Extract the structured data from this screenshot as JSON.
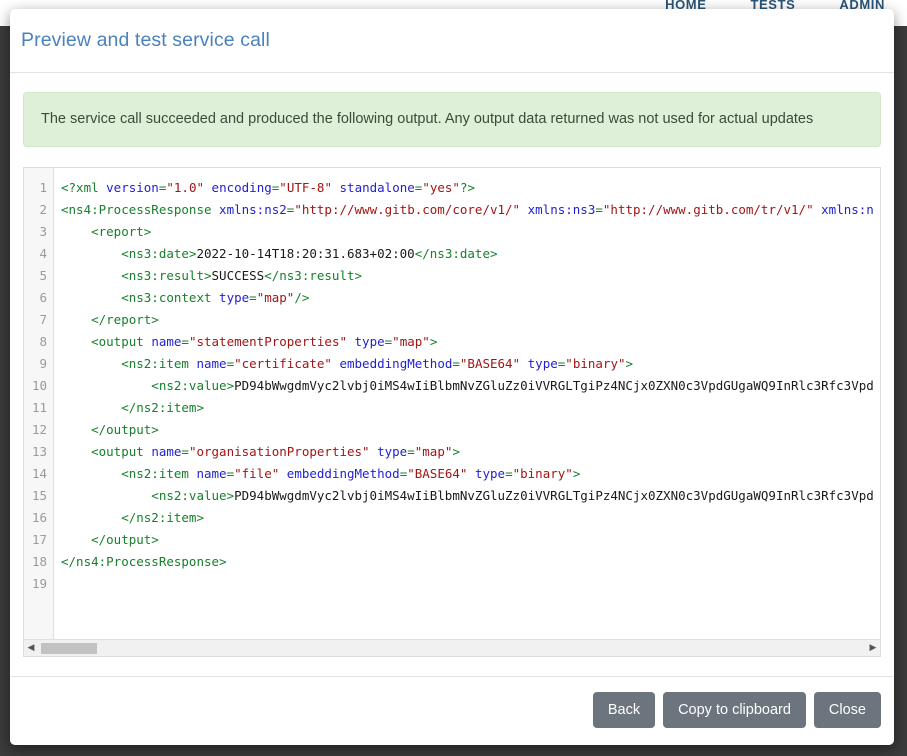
{
  "background_nav": {
    "links": [
      {
        "label": "HOME"
      },
      {
        "label": "TESTS"
      },
      {
        "label": "ADMIN"
      }
    ]
  },
  "modal": {
    "title": "Preview and test service call",
    "alert": {
      "type": "success",
      "bg_color": "#dff0d8",
      "message": "The service call succeeded and produced the following output. Any output data returned was not used for actual updates"
    },
    "editor": {
      "language": "xml",
      "line_count": 19,
      "line_numbers": [
        "1",
        "2",
        "3",
        "4",
        "5",
        "6",
        "7",
        "8",
        "9",
        "10",
        "11",
        "12",
        "13",
        "14",
        "15",
        "16",
        "17",
        "18",
        "19"
      ],
      "lines": [
        {
          "n": "1",
          "tokens": [
            {
              "t": "punct",
              "v": "<?xml "
            },
            {
              "t": "attr",
              "v": "version"
            },
            {
              "t": "punct",
              "v": "="
            },
            {
              "t": "val",
              "v": "\"1.0\""
            },
            {
              "t": "punct",
              "v": " "
            },
            {
              "t": "attr",
              "v": "encoding"
            },
            {
              "t": "punct",
              "v": "="
            },
            {
              "t": "val",
              "v": "\"UTF-8\""
            },
            {
              "t": "punct",
              "v": " "
            },
            {
              "t": "attr",
              "v": "standalone"
            },
            {
              "t": "punct",
              "v": "="
            },
            {
              "t": "val",
              "v": "\"yes\""
            },
            {
              "t": "punct",
              "v": "?>"
            }
          ]
        },
        {
          "n": "2",
          "tokens": [
            {
              "t": "tag",
              "v": "<ns4:ProcessResponse "
            },
            {
              "t": "attr",
              "v": "xmlns:ns2"
            },
            {
              "t": "punct",
              "v": "="
            },
            {
              "t": "val",
              "v": "\"http://www.gitb.com/core/v1/\""
            },
            {
              "t": "punct",
              "v": " "
            },
            {
              "t": "attr",
              "v": "xmlns:ns3"
            },
            {
              "t": "punct",
              "v": "="
            },
            {
              "t": "val",
              "v": "\"http://www.gitb.com/tr/v1/\""
            },
            {
              "t": "punct",
              "v": " "
            },
            {
              "t": "attr",
              "v": "xmlns:n"
            }
          ]
        },
        {
          "n": "3",
          "tokens": [
            {
              "t": "tag",
              "v": "    <report>"
            }
          ]
        },
        {
          "n": "4",
          "tokens": [
            {
              "t": "tag",
              "v": "        <ns3:date>"
            },
            {
              "t": "text",
              "v": "2022-10-14T18:20:31.683+02:00"
            },
            {
              "t": "tag",
              "v": "</ns3:date>"
            }
          ]
        },
        {
          "n": "5",
          "tokens": [
            {
              "t": "tag",
              "v": "        <ns3:result>"
            },
            {
              "t": "text",
              "v": "SUCCESS"
            },
            {
              "t": "tag",
              "v": "</ns3:result>"
            }
          ]
        },
        {
          "n": "6",
          "tokens": [
            {
              "t": "tag",
              "v": "        <ns3:context "
            },
            {
              "t": "attr",
              "v": "type"
            },
            {
              "t": "punct",
              "v": "="
            },
            {
              "t": "val",
              "v": "\"map\""
            },
            {
              "t": "tag",
              "v": "/>"
            }
          ]
        },
        {
          "n": "7",
          "tokens": [
            {
              "t": "tag",
              "v": "    </report>"
            }
          ]
        },
        {
          "n": "8",
          "tokens": [
            {
              "t": "tag",
              "v": "    <output "
            },
            {
              "t": "attr",
              "v": "name"
            },
            {
              "t": "punct",
              "v": "="
            },
            {
              "t": "val",
              "v": "\"statementProperties\""
            },
            {
              "t": "punct",
              "v": " "
            },
            {
              "t": "attr",
              "v": "type"
            },
            {
              "t": "punct",
              "v": "="
            },
            {
              "t": "val",
              "v": "\"map\""
            },
            {
              "t": "tag",
              "v": ">"
            }
          ]
        },
        {
          "n": "9",
          "tokens": [
            {
              "t": "tag",
              "v": "        <ns2:item "
            },
            {
              "t": "attr",
              "v": "name"
            },
            {
              "t": "punct",
              "v": "="
            },
            {
              "t": "val",
              "v": "\"certificate\""
            },
            {
              "t": "punct",
              "v": " "
            },
            {
              "t": "attr",
              "v": "embeddingMethod"
            },
            {
              "t": "punct",
              "v": "="
            },
            {
              "t": "val",
              "v": "\"BASE64\""
            },
            {
              "t": "punct",
              "v": " "
            },
            {
              "t": "attr",
              "v": "type"
            },
            {
              "t": "punct",
              "v": "="
            },
            {
              "t": "val",
              "v": "\"binary\""
            },
            {
              "t": "tag",
              "v": ">"
            }
          ]
        },
        {
          "n": "10",
          "tokens": [
            {
              "t": "tag",
              "v": "            <ns2:value>"
            },
            {
              "t": "text",
              "v": "PD94bWwgdmVyc2lvbj0iMS4wIiBlbmNvZGluZz0iVVRGLTgiPz4NCjx0ZXN0c3VpdGUgaWQ9InRlc3Rfc3Vpd"
            }
          ]
        },
        {
          "n": "11",
          "tokens": [
            {
              "t": "tag",
              "v": "        </ns2:item>"
            }
          ]
        },
        {
          "n": "12",
          "tokens": [
            {
              "t": "tag",
              "v": "    </output>"
            }
          ]
        },
        {
          "n": "13",
          "tokens": [
            {
              "t": "tag",
              "v": "    <output "
            },
            {
              "t": "attr",
              "v": "name"
            },
            {
              "t": "punct",
              "v": "="
            },
            {
              "t": "val",
              "v": "\"organisationProperties\""
            },
            {
              "t": "punct",
              "v": " "
            },
            {
              "t": "attr",
              "v": "type"
            },
            {
              "t": "punct",
              "v": "="
            },
            {
              "t": "val",
              "v": "\"map\""
            },
            {
              "t": "tag",
              "v": ">"
            }
          ]
        },
        {
          "n": "14",
          "tokens": [
            {
              "t": "tag",
              "v": "        <ns2:item "
            },
            {
              "t": "attr",
              "v": "name"
            },
            {
              "t": "punct",
              "v": "="
            },
            {
              "t": "val",
              "v": "\"file\""
            },
            {
              "t": "punct",
              "v": " "
            },
            {
              "t": "attr",
              "v": "embeddingMethod"
            },
            {
              "t": "punct",
              "v": "="
            },
            {
              "t": "val",
              "v": "\"BASE64\""
            },
            {
              "t": "punct",
              "v": " "
            },
            {
              "t": "attr",
              "v": "type"
            },
            {
              "t": "punct",
              "v": "="
            },
            {
              "t": "val",
              "v": "\"binary\""
            },
            {
              "t": "tag",
              "v": ">"
            }
          ]
        },
        {
          "n": "15",
          "tokens": [
            {
              "t": "tag",
              "v": "            <ns2:value>"
            },
            {
              "t": "text",
              "v": "PD94bWwgdmVyc2lvbj0iMS4wIiBlbmNvZGluZz0iVVRGLTgiPz4NCjx0ZXN0c3VpdGUgaWQ9InRlc3Rfc3Vpd"
            }
          ]
        },
        {
          "n": "16",
          "tokens": [
            {
              "t": "tag",
              "v": "        </ns2:item>"
            }
          ]
        },
        {
          "n": "17",
          "tokens": [
            {
              "t": "tag",
              "v": "    </output>"
            }
          ]
        },
        {
          "n": "18",
          "tokens": [
            {
              "t": "tag",
              "v": "</ns4:ProcessResponse>"
            }
          ]
        },
        {
          "n": "19",
          "tokens": []
        }
      ],
      "scrollbar": {
        "left_arrow": "◀",
        "right_arrow": "▶",
        "thumb_position": "start"
      }
    },
    "footer": {
      "buttons": [
        {
          "label": "Back",
          "name": "back-button"
        },
        {
          "label": "Copy to clipboard",
          "name": "copy-to-clipboard-button"
        },
        {
          "label": "Close",
          "name": "close-button"
        }
      ],
      "button_color": "#6c757d"
    }
  }
}
